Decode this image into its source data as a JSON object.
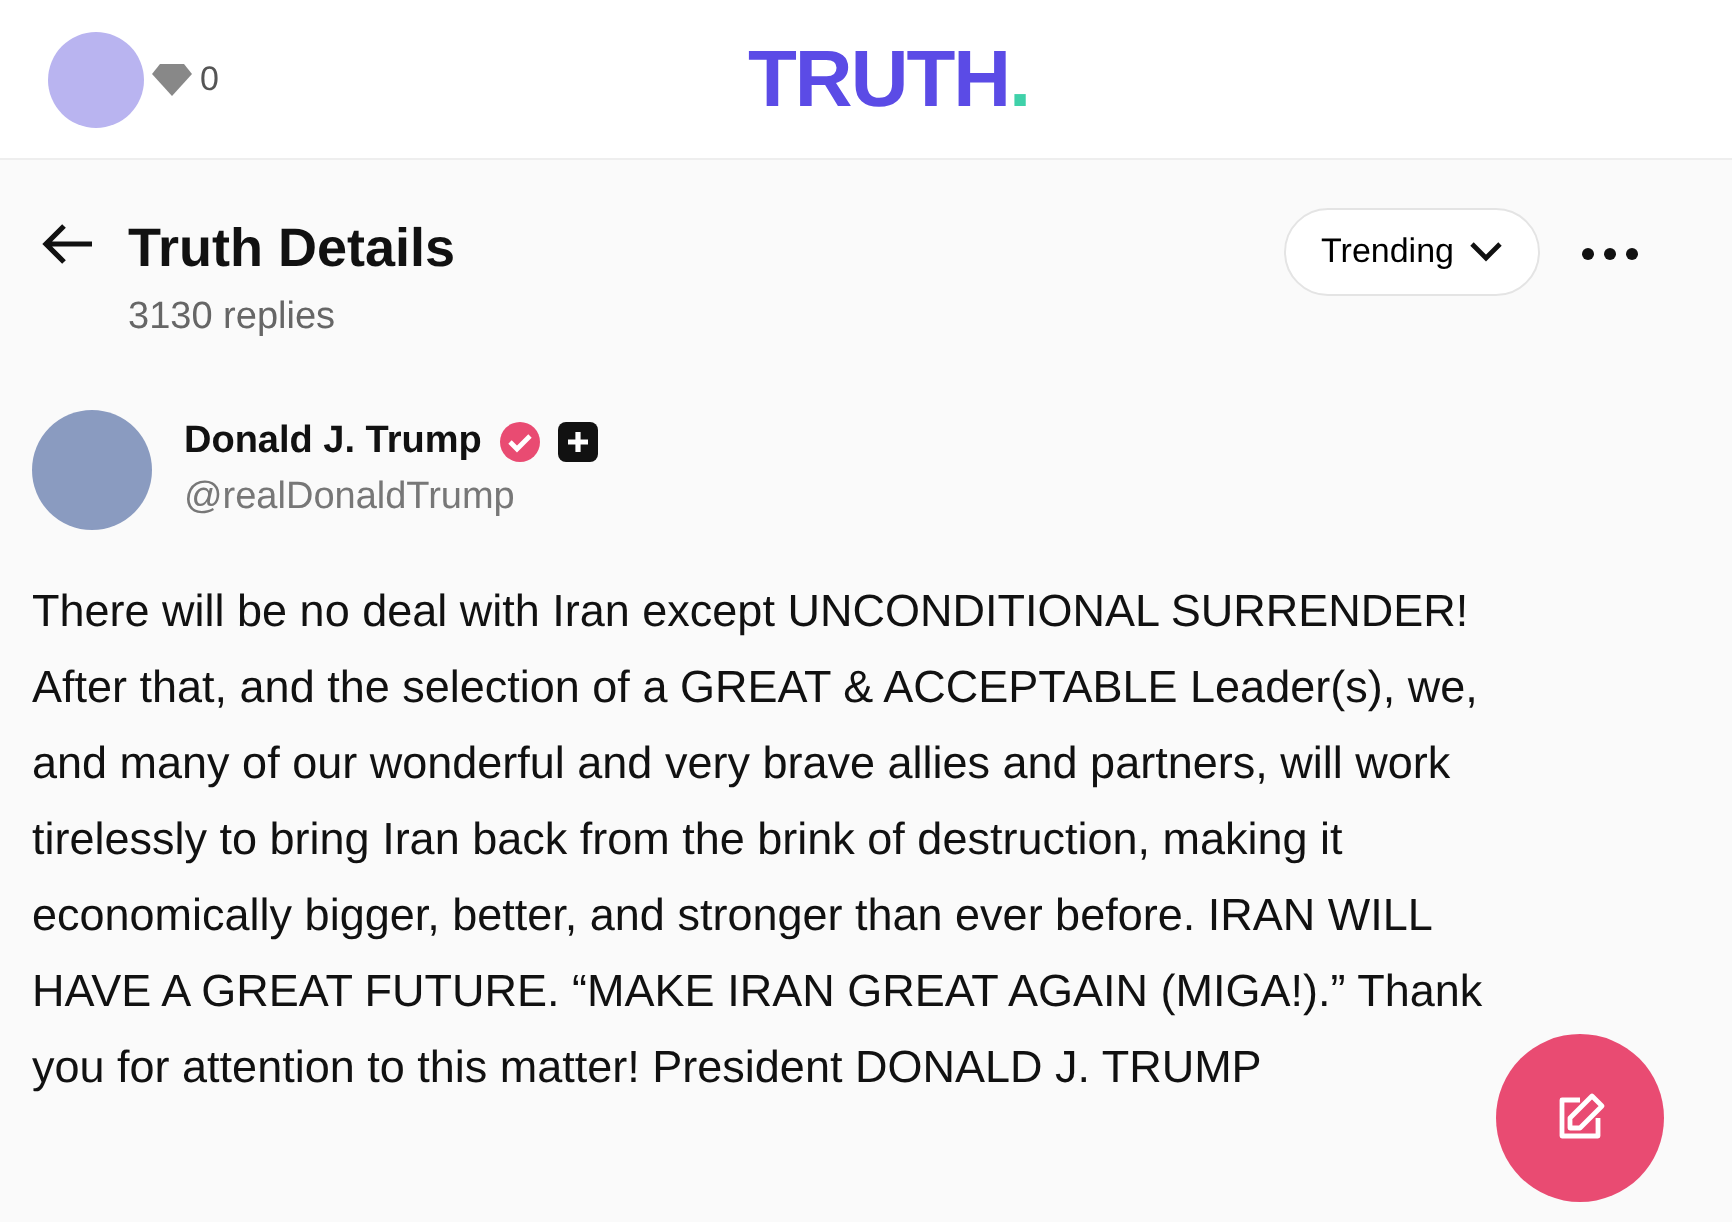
{
  "top_bar": {
    "points": "0",
    "logo": "TRUTH",
    "logo_dot": "."
  },
  "header": {
    "title": "Truth Details",
    "replies": "3130 replies",
    "sort": "Trending"
  },
  "post": {
    "author": "Donald J. Trump",
    "handle": "@realDonaldTrump",
    "verified": true,
    "text": "There will be no deal with Iran except UNCONDITIONAL SURRENDER! After that, and the selection of a GREAT & ACCEPTABLE Leader(s), we, and many of our wonderful and very brave allies and partners, will work tirelessly to bring Iran back from the brink of destruction, making it economically bigger, better, and stronger than ever before. IRAN WILL HAVE A GREAT FUTURE. “MAKE IRAN GREAT AGAIN (MIGA!).” Thank you for attention to this matter! President DONALD J. TRUMP"
  }
}
